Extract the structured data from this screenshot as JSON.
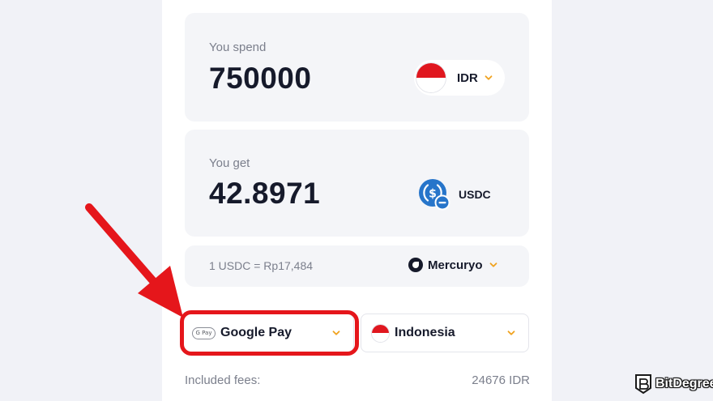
{
  "spend": {
    "label": "You spend",
    "amount": "750000",
    "currency": "IDR"
  },
  "get": {
    "label": "You get",
    "amount": "42.8971",
    "currency": "USDC"
  },
  "rate": {
    "text": "1 USDC = Rp17,484",
    "provider": "Mercuryo"
  },
  "payment": {
    "badge": "G Pay",
    "method": "Google Pay",
    "country": "Indonesia"
  },
  "fees": {
    "label": "Included fees:",
    "value": "24676 IDR"
  },
  "watermark": {
    "brand": "BitDegree"
  },
  "colors": {
    "accent_chevron": "#f0a21e",
    "highlight_red": "#e5161b",
    "usdc_blue": "#2775ca",
    "flag_red": "#e0171f"
  },
  "icons": {
    "currency_flag": "indonesia-flag-icon",
    "usdc": "usdc-icon",
    "provider": "mercuryo-logo-icon",
    "chevron": "chevron-down-icon"
  }
}
